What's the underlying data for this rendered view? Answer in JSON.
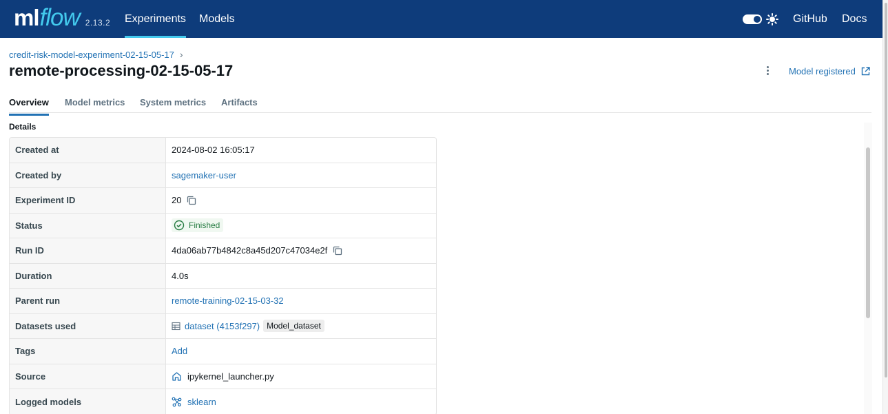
{
  "header": {
    "logo_ml": "ml",
    "logo_flow": "flow",
    "version": "2.13.2",
    "nav": [
      "Experiments",
      "Models"
    ],
    "github": "GitHub",
    "docs": "Docs"
  },
  "breadcrumb": {
    "experiment": "credit-risk-model-experiment-02-15-05-17",
    "chevron": "›"
  },
  "title": "remote-processing-02-15-05-17",
  "actions": {
    "model_registered": "Model registered"
  },
  "tabs": [
    "Overview",
    "Model metrics",
    "System metrics",
    "Artifacts"
  ],
  "details_heading": "Details",
  "details": {
    "created_at": {
      "label": "Created at",
      "value": "2024-08-02 16:05:17"
    },
    "created_by": {
      "label": "Created by",
      "value": "sagemaker-user"
    },
    "experiment_id": {
      "label": "Experiment ID",
      "value": "20"
    },
    "status": {
      "label": "Status",
      "value": "Finished"
    },
    "run_id": {
      "label": "Run ID",
      "value": "4da06ab77b4842c8a45d207c47034e2f"
    },
    "duration": {
      "label": "Duration",
      "value": "4.0s"
    },
    "parent_run": {
      "label": "Parent run",
      "value": "remote-training-02-15-03-32"
    },
    "datasets_used": {
      "label": "Datasets used",
      "value": "dataset (4153f297)",
      "tag": "Model_dataset"
    },
    "tags": {
      "label": "Tags",
      "value": "Add"
    },
    "source": {
      "label": "Source",
      "value": "ipykernel_launcher.py"
    },
    "logged_models": {
      "label": "Logged models",
      "value": "sklearn"
    }
  },
  "colors": {
    "header_bg": "#0e3c7b",
    "accent": "#43c9ed",
    "link": "#2272b4",
    "status_green": "#277c43"
  },
  "icons": {
    "theme_toggle": "toggle-icon",
    "theme": "sun-icon",
    "more": "kebab-menu-icon",
    "external": "external-link-icon",
    "copy": "copy-icon",
    "status": "check-circle-icon",
    "dataset": "table-icon",
    "source": "notebook-icon",
    "model": "model-icon"
  }
}
